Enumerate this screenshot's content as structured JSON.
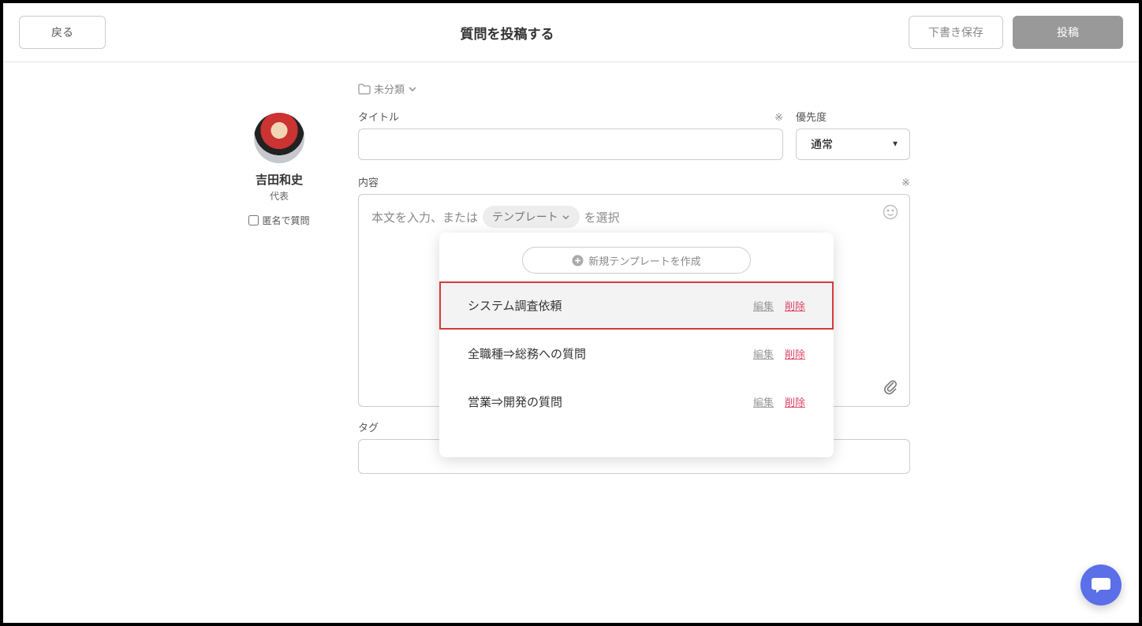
{
  "header": {
    "back_label": "戻る",
    "title": "質問を投稿する",
    "draft_label": "下書き保存",
    "post_label": "投稿"
  },
  "user": {
    "name": "吉田和史",
    "role": "代表",
    "anonymous_label": "匿名で質問"
  },
  "category": {
    "label": "未分類"
  },
  "fields": {
    "title_label": "タイトル",
    "required_mark": "※",
    "priority_label": "優先度",
    "priority_value": "通常",
    "content_label": "内容",
    "content_placeholder_pre": "本文を入力、または",
    "content_placeholder_post": "を選択",
    "template_chip": "テンプレート",
    "tag_label": "タグ"
  },
  "template_dropdown": {
    "new_label": "新規テンプレートを作成",
    "edit_label": "編集",
    "delete_label": "削除",
    "items": [
      {
        "name": "システム調査依頼"
      },
      {
        "name": "全職種⇒総務への質問"
      },
      {
        "name": "営業⇒開発の質問"
      }
    ]
  }
}
